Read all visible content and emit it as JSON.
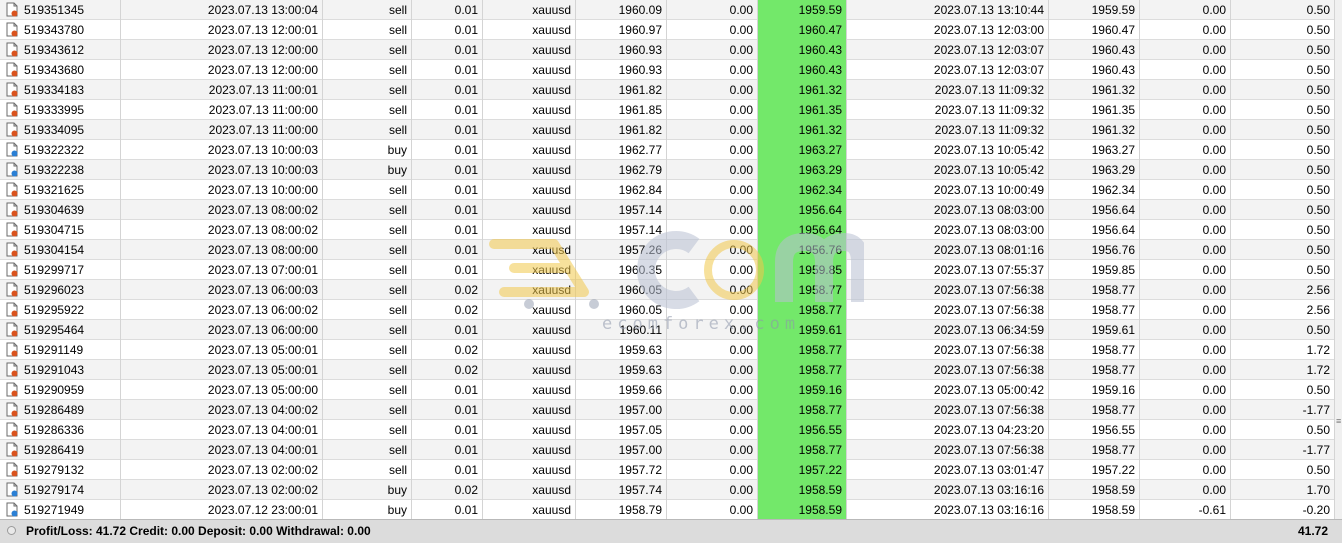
{
  "rows": [
    {
      "ticket": "519351345",
      "open_time": "2023.07.13 13:00:04",
      "type": "sell",
      "size": "0.01",
      "symbol": "xauusd",
      "open_price": "1960.09",
      "sl": "0.00",
      "tp": "1959.59",
      "close_time": "2023.07.13 13:10:44",
      "close_price": "1959.59",
      "swap": "0.00",
      "profit": "0.50"
    },
    {
      "ticket": "519343780",
      "open_time": "2023.07.13 12:00:01",
      "type": "sell",
      "size": "0.01",
      "symbol": "xauusd",
      "open_price": "1960.97",
      "sl": "0.00",
      "tp": "1960.47",
      "close_time": "2023.07.13 12:03:00",
      "close_price": "1960.47",
      "swap": "0.00",
      "profit": "0.50"
    },
    {
      "ticket": "519343612",
      "open_time": "2023.07.13 12:00:00",
      "type": "sell",
      "size": "0.01",
      "symbol": "xauusd",
      "open_price": "1960.93",
      "sl": "0.00",
      "tp": "1960.43",
      "close_time": "2023.07.13 12:03:07",
      "close_price": "1960.43",
      "swap": "0.00",
      "profit": "0.50"
    },
    {
      "ticket": "519343680",
      "open_time": "2023.07.13 12:00:00",
      "type": "sell",
      "size": "0.01",
      "symbol": "xauusd",
      "open_price": "1960.93",
      "sl": "0.00",
      "tp": "1960.43",
      "close_time": "2023.07.13 12:03:07",
      "close_price": "1960.43",
      "swap": "0.00",
      "profit": "0.50"
    },
    {
      "ticket": "519334183",
      "open_time": "2023.07.13 11:00:01",
      "type": "sell",
      "size": "0.01",
      "symbol": "xauusd",
      "open_price": "1961.82",
      "sl": "0.00",
      "tp": "1961.32",
      "close_time": "2023.07.13 11:09:32",
      "close_price": "1961.32",
      "swap": "0.00",
      "profit": "0.50"
    },
    {
      "ticket": "519333995",
      "open_time": "2023.07.13 11:00:00",
      "type": "sell",
      "size": "0.01",
      "symbol": "xauusd",
      "open_price": "1961.85",
      "sl": "0.00",
      "tp": "1961.35",
      "close_time": "2023.07.13 11:09:32",
      "close_price": "1961.35",
      "swap": "0.00",
      "profit": "0.50"
    },
    {
      "ticket": "519334095",
      "open_time": "2023.07.13 11:00:00",
      "type": "sell",
      "size": "0.01",
      "symbol": "xauusd",
      "open_price": "1961.82",
      "sl": "0.00",
      "tp": "1961.32",
      "close_time": "2023.07.13 11:09:32",
      "close_price": "1961.32",
      "swap": "0.00",
      "profit": "0.50"
    },
    {
      "ticket": "519322322",
      "open_time": "2023.07.13 10:00:03",
      "type": "buy",
      "size": "0.01",
      "symbol": "xauusd",
      "open_price": "1962.77",
      "sl": "0.00",
      "tp": "1963.27",
      "close_time": "2023.07.13 10:05:42",
      "close_price": "1963.27",
      "swap": "0.00",
      "profit": "0.50"
    },
    {
      "ticket": "519322238",
      "open_time": "2023.07.13 10:00:03",
      "type": "buy",
      "size": "0.01",
      "symbol": "xauusd",
      "open_price": "1962.79",
      "sl": "0.00",
      "tp": "1963.29",
      "close_time": "2023.07.13 10:05:42",
      "close_price": "1963.29",
      "swap": "0.00",
      "profit": "0.50"
    },
    {
      "ticket": "519321625",
      "open_time": "2023.07.13 10:00:00",
      "type": "sell",
      "size": "0.01",
      "symbol": "xauusd",
      "open_price": "1962.84",
      "sl": "0.00",
      "tp": "1962.34",
      "close_time": "2023.07.13 10:00:49",
      "close_price": "1962.34",
      "swap": "0.00",
      "profit": "0.50"
    },
    {
      "ticket": "519304639",
      "open_time": "2023.07.13 08:00:02",
      "type": "sell",
      "size": "0.01",
      "symbol": "xauusd",
      "open_price": "1957.14",
      "sl": "0.00",
      "tp": "1956.64",
      "close_time": "2023.07.13 08:03:00",
      "close_price": "1956.64",
      "swap": "0.00",
      "profit": "0.50"
    },
    {
      "ticket": "519304715",
      "open_time": "2023.07.13 08:00:02",
      "type": "sell",
      "size": "0.01",
      "symbol": "xauusd",
      "open_price": "1957.14",
      "sl": "0.00",
      "tp": "1956.64",
      "close_time": "2023.07.13 08:03:00",
      "close_price": "1956.64",
      "swap": "0.00",
      "profit": "0.50"
    },
    {
      "ticket": "519304154",
      "open_time": "2023.07.13 08:00:00",
      "type": "sell",
      "size": "0.01",
      "symbol": "xauusd",
      "open_price": "1957.26",
      "sl": "0.00",
      "tp": "1956.76",
      "close_time": "2023.07.13 08:01:16",
      "close_price": "1956.76",
      "swap": "0.00",
      "profit": "0.50"
    },
    {
      "ticket": "519299717",
      "open_time": "2023.07.13 07:00:01",
      "type": "sell",
      "size": "0.01",
      "symbol": "xauusd",
      "open_price": "1960.35",
      "sl": "0.00",
      "tp": "1959.85",
      "close_time": "2023.07.13 07:55:37",
      "close_price": "1959.85",
      "swap": "0.00",
      "profit": "0.50"
    },
    {
      "ticket": "519296023",
      "open_time": "2023.07.13 06:00:03",
      "type": "sell",
      "size": "0.02",
      "symbol": "xauusd",
      "open_price": "1960.05",
      "sl": "0.00",
      "tp": "1958.77",
      "close_time": "2023.07.13 07:56:38",
      "close_price": "1958.77",
      "swap": "0.00",
      "profit": "2.56"
    },
    {
      "ticket": "519295922",
      "open_time": "2023.07.13 06:00:02",
      "type": "sell",
      "size": "0.02",
      "symbol": "xauusd",
      "open_price": "1960.05",
      "sl": "0.00",
      "tp": "1958.77",
      "close_time": "2023.07.13 07:56:38",
      "close_price": "1958.77",
      "swap": "0.00",
      "profit": "2.56"
    },
    {
      "ticket": "519295464",
      "open_time": "2023.07.13 06:00:00",
      "type": "sell",
      "size": "0.01",
      "symbol": "xauusd",
      "open_price": "1960.11",
      "sl": "0.00",
      "tp": "1959.61",
      "close_time": "2023.07.13 06:34:59",
      "close_price": "1959.61",
      "swap": "0.00",
      "profit": "0.50"
    },
    {
      "ticket": "519291149",
      "open_time": "2023.07.13 05:00:01",
      "type": "sell",
      "size": "0.02",
      "symbol": "xauusd",
      "open_price": "1959.63",
      "sl": "0.00",
      "tp": "1958.77",
      "close_time": "2023.07.13 07:56:38",
      "close_price": "1958.77",
      "swap": "0.00",
      "profit": "1.72"
    },
    {
      "ticket": "519291043",
      "open_time": "2023.07.13 05:00:01",
      "type": "sell",
      "size": "0.02",
      "symbol": "xauusd",
      "open_price": "1959.63",
      "sl": "0.00",
      "tp": "1958.77",
      "close_time": "2023.07.13 07:56:38",
      "close_price": "1958.77",
      "swap": "0.00",
      "profit": "1.72"
    },
    {
      "ticket": "519290959",
      "open_time": "2023.07.13 05:00:00",
      "type": "sell",
      "size": "0.01",
      "symbol": "xauusd",
      "open_price": "1959.66",
      "sl": "0.00",
      "tp": "1959.16",
      "close_time": "2023.07.13 05:00:42",
      "close_price": "1959.16",
      "swap": "0.00",
      "profit": "0.50"
    },
    {
      "ticket": "519286489",
      "open_time": "2023.07.13 04:00:02",
      "type": "sell",
      "size": "0.01",
      "symbol": "xauusd",
      "open_price": "1957.00",
      "sl": "0.00",
      "tp": "1958.77",
      "close_time": "2023.07.13 07:56:38",
      "close_price": "1958.77",
      "swap": "0.00",
      "profit": "-1.77"
    },
    {
      "ticket": "519286336",
      "open_time": "2023.07.13 04:00:01",
      "type": "sell",
      "size": "0.01",
      "symbol": "xauusd",
      "open_price": "1957.05",
      "sl": "0.00",
      "tp": "1956.55",
      "close_time": "2023.07.13 04:23:20",
      "close_price": "1956.55",
      "swap": "0.00",
      "profit": "0.50"
    },
    {
      "ticket": "519286419",
      "open_time": "2023.07.13 04:00:01",
      "type": "sell",
      "size": "0.01",
      "symbol": "xauusd",
      "open_price": "1957.00",
      "sl": "0.00",
      "tp": "1958.77",
      "close_time": "2023.07.13 07:56:38",
      "close_price": "1958.77",
      "swap": "0.00",
      "profit": "-1.77"
    },
    {
      "ticket": "519279132",
      "open_time": "2023.07.13 02:00:02",
      "type": "sell",
      "size": "0.01",
      "symbol": "xauusd",
      "open_price": "1957.72",
      "sl": "0.00",
      "tp": "1957.22",
      "close_time": "2023.07.13 03:01:47",
      "close_price": "1957.22",
      "swap": "0.00",
      "profit": "0.50"
    },
    {
      "ticket": "519279174",
      "open_time": "2023.07.13 02:00:02",
      "type": "buy",
      "size": "0.02",
      "symbol": "xauusd",
      "open_price": "1957.74",
      "sl": "0.00",
      "tp": "1958.59",
      "close_time": "2023.07.13 03:16:16",
      "close_price": "1958.59",
      "swap": "0.00",
      "profit": "1.70"
    },
    {
      "ticket": "519271949",
      "open_time": "2023.07.12 23:00:01",
      "type": "buy",
      "size": "0.01",
      "symbol": "xauusd",
      "open_price": "1958.79",
      "sl": "0.00",
      "tp": "1958.59",
      "close_time": "2023.07.13 03:16:16",
      "close_price": "1958.59",
      "swap": "-0.61",
      "profit": "-0.20"
    }
  ],
  "colors": {
    "tp_highlight": "#73e86a",
    "sell_icon": "#d9531e",
    "buy_icon": "#2a7fd4"
  },
  "icons": {
    "sell": "sell-order-icon",
    "buy": "buy-order-icon",
    "footer": "balance-icon"
  },
  "footer": {
    "summary": "Profit/Loss: 41.72  Credit: 0.00  Deposit: 0.00  Withdrawal: 0.00",
    "total": "41.72"
  },
  "watermark": {
    "brand": "ecom",
    "site": "ecomforex.com"
  }
}
